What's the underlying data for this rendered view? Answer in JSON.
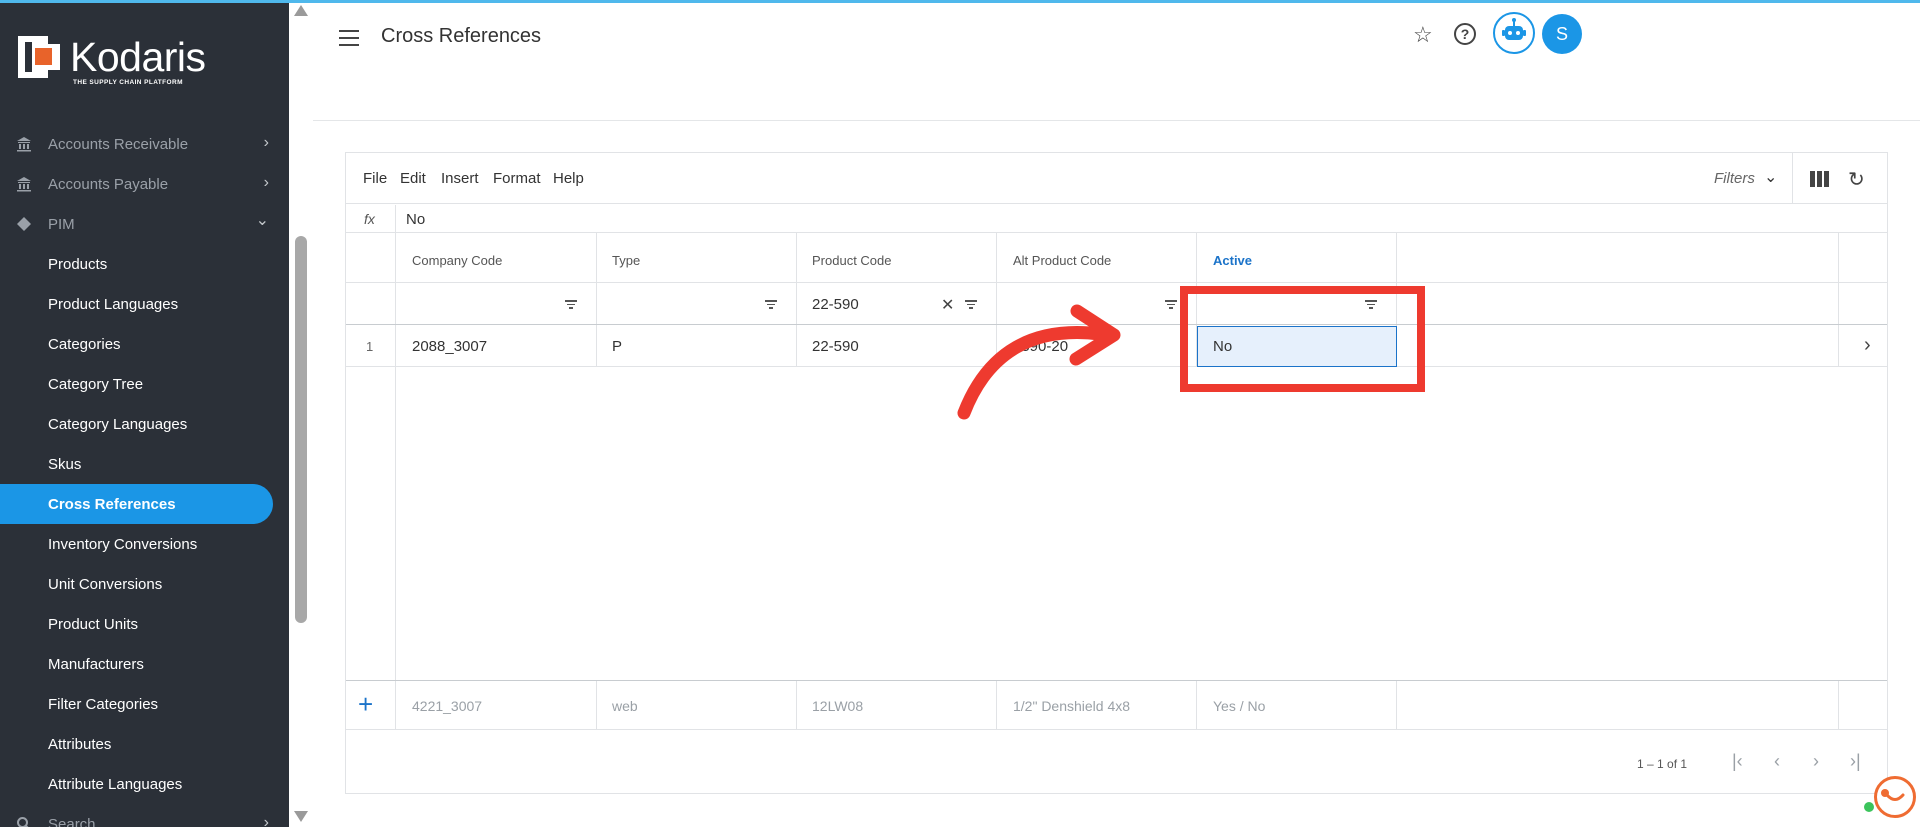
{
  "brand": {
    "name": "Kodaris",
    "tagline": "THE SUPPLY CHAIN PLATFORM",
    "accent_color": "#1b96e6",
    "sidebar_color": "#2b3038"
  },
  "sidebar": {
    "items": [
      {
        "label": "Accounts Receivable",
        "kind": "group",
        "icon": "bank-icon",
        "chevron": "›"
      },
      {
        "label": "Accounts Payable",
        "kind": "group",
        "icon": "bank-icon",
        "chevron": "›"
      },
      {
        "label": "PIM",
        "kind": "group",
        "icon": "tag-icon",
        "chevron": "⌄"
      },
      {
        "label": "Products",
        "kind": "sub"
      },
      {
        "label": "Product Languages",
        "kind": "sub"
      },
      {
        "label": "Categories",
        "kind": "sub"
      },
      {
        "label": "Category Tree",
        "kind": "sub"
      },
      {
        "label": "Category Languages",
        "kind": "sub"
      },
      {
        "label": "Skus",
        "kind": "sub"
      },
      {
        "label": "Cross References",
        "kind": "sub",
        "active": true
      },
      {
        "label": "Inventory Conversions",
        "kind": "sub"
      },
      {
        "label": "Unit Conversions",
        "kind": "sub"
      },
      {
        "label": "Product Units",
        "kind": "sub"
      },
      {
        "label": "Manufacturers",
        "kind": "sub"
      },
      {
        "label": "Filter Categories",
        "kind": "sub"
      },
      {
        "label": "Attributes",
        "kind": "sub"
      },
      {
        "label": "Attribute Languages",
        "kind": "sub"
      },
      {
        "label": "Search",
        "kind": "group",
        "icon": "search-icon",
        "chevron": "›"
      }
    ]
  },
  "header": {
    "title": "Cross References",
    "avatar_initial": "S",
    "star_glyph": "☆",
    "help_glyph": "?"
  },
  "toolbar": {
    "menus": [
      "File",
      "Edit",
      "Insert",
      "Format",
      "Help"
    ],
    "filters_label": "Filters",
    "filters_chevron": "⌄",
    "refresh_glyph": "↻"
  },
  "formula_bar": {
    "label": "fx",
    "value": "No"
  },
  "grid": {
    "columns": [
      "Company Code",
      "Type",
      "Product Code",
      "Alt Product Code",
      "Active"
    ],
    "active_column": "Active",
    "filters": [
      "",
      "",
      "22-590",
      "",
      ""
    ],
    "clear_glyph": "✕",
    "rows": [
      {
        "num": "1",
        "cells": [
          "2088_3007",
          "P",
          "22-590",
          "2590-20",
          "No"
        ]
      }
    ],
    "row_arrow": "›",
    "new_row": {
      "plus": "+",
      "placeholders": [
        "4221_3007",
        "web",
        "12LW08",
        "1/2\" Denshield 4x8",
        "Yes / No"
      ]
    }
  },
  "pager": {
    "text": "1 – 1 of 1",
    "first": "|‹",
    "prev": "‹",
    "next": "›",
    "last": "›|"
  },
  "annotation": {
    "color": "#ee3a2f"
  }
}
